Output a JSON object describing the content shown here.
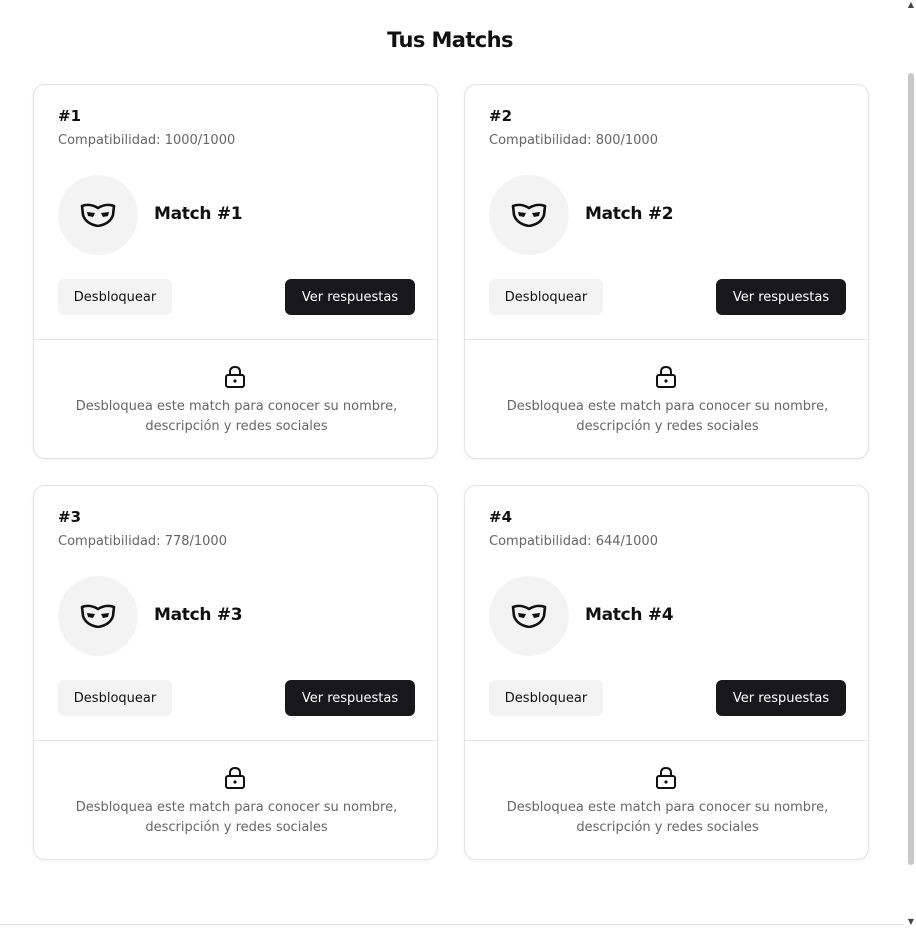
{
  "page": {
    "title": "Tus Matchs"
  },
  "matches": [
    {
      "number": "#1",
      "compatibility": "Compatibilidad: 1000/1000",
      "name": "Match #1",
      "unlock_label": "Desbloquear",
      "answers_label": "Ver respuestas",
      "locked_line1": "Desbloquea este match para conocer su nombre,",
      "locked_line2": "descripción y redes sociales"
    },
    {
      "number": "#2",
      "compatibility": "Compatibilidad: 800/1000",
      "name": "Match #2",
      "unlock_label": "Desbloquear",
      "answers_label": "Ver respuestas",
      "locked_line1": "Desbloquea este match para conocer su nombre,",
      "locked_line2": "descripción y redes sociales"
    },
    {
      "number": "#3",
      "compatibility": "Compatibilidad: 778/1000",
      "name": "Match #3",
      "unlock_label": "Desbloquear",
      "answers_label": "Ver respuestas",
      "locked_line1": "Desbloquea este match para conocer su nombre,",
      "locked_line2": "descripción y redes sociales"
    },
    {
      "number": "#4",
      "compatibility": "Compatibilidad: 644/1000",
      "name": "Match #4",
      "unlock_label": "Desbloquear",
      "answers_label": "Ver respuestas",
      "locked_line1": "Desbloquea este match para conocer su nombre,",
      "locked_line2": "descripción y redes sociales"
    }
  ],
  "icons": {
    "avatar": "mask-icon",
    "locked": "lock-icon",
    "scroll_up": "arrow-up-icon",
    "scroll_down": "arrow-down-icon"
  },
  "colors": {
    "primary_button": "#18181b",
    "secondary_button": "#f3f3f3",
    "avatar_bg": "#f3f3f3",
    "muted_text": "#666666"
  }
}
